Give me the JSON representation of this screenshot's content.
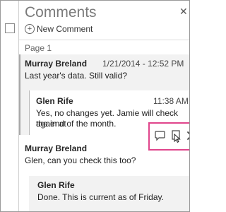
{
  "pane": {
    "title": "Comments",
    "close_icon": "close-icon",
    "new_comment_label": "New Comment",
    "page_label": "Page 1"
  },
  "threads": [
    {
      "author": "Murray Breland",
      "timestamp": "1/21/2014 - 12:52 PM",
      "text": "Last year's data. Still valid?",
      "reply": {
        "author": "Glen Rife",
        "timestamp": "11:38 AM",
        "text_line1": "Yes, no changes yet. Jamie will check again at",
        "text_line2": "the end of the month."
      }
    },
    {
      "author": "Murray Breland",
      "text": "Glen, can you check this too?",
      "reply": {
        "author": "Glen Rife",
        "text": "Done. This is current as of Friday."
      }
    }
  ],
  "actions": {
    "reply_icon": "reply-icon",
    "resolve_icon": "resolve-icon",
    "delete_icon": "delete-icon",
    "highlight_color": "#e0458c"
  },
  "colors": {
    "selected_thread_bg": "#f2f2f2",
    "accent_bar": "#a8a8a8",
    "title": "#7a7a7a"
  }
}
